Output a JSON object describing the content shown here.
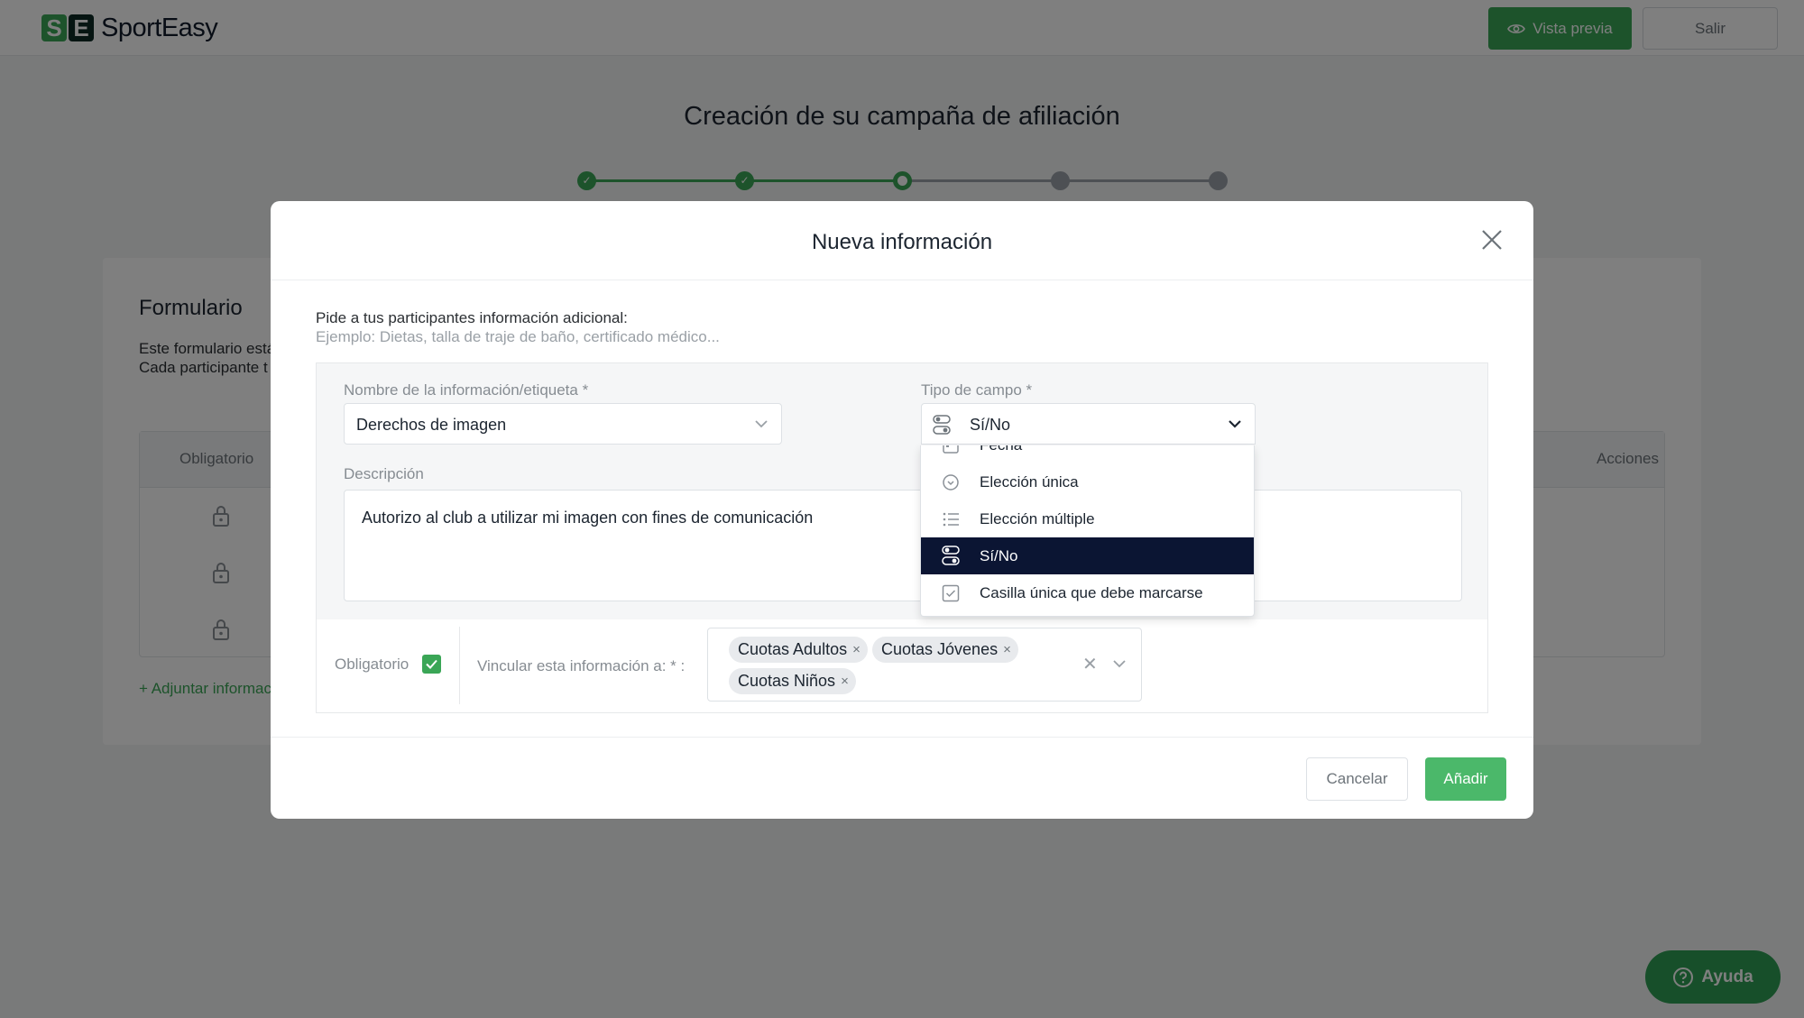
{
  "app": {
    "brand": "SportEasy",
    "logo_mark": [
      "S",
      "E"
    ]
  },
  "header": {
    "preview_label": "Vista previa",
    "exit_label": "Salir"
  },
  "page": {
    "title": "Creación de su campaña de afiliación"
  },
  "stepper": {
    "total_steps": 5,
    "completed_steps": 2,
    "current_step": 3,
    "check_glyph": "✓"
  },
  "form": {
    "title": "Formulario",
    "desc_line_1": "Este formulario está",
    "desc_line_2": "Cada participante t",
    "table_header_required": "Obligatorio",
    "table_header_actions": "Acciones",
    "attach_link": "+ Adjuntar informac"
  },
  "help": {
    "label": "Ayuda"
  },
  "modal": {
    "title": "Nueva información",
    "intro": "Pide a tus participantes información adicional:",
    "example": "Ejemplo: Dietas, talla de traje de baño, certificado médico...",
    "name_label": "Nombre de la información/etiqueta *",
    "name_value": "Derechos de imagen",
    "type_label": "Tipo de campo *",
    "type_value": "Sí/No",
    "description_label": "Descripción",
    "description_value": "Autorizo al club a utilizar mi imagen con fines de comunicación",
    "required_label": "Obligatorio",
    "required_checked": true,
    "link_label": "Vincular esta información a: * :",
    "linked_tags": [
      {
        "label": "Cuotas Adultos",
        "x": "×"
      },
      {
        "label": "Cuotas Jóvenes",
        "x": "×"
      },
      {
        "label": "Cuotas Niños",
        "x": "×"
      }
    ],
    "clear_glyph": "✕",
    "cancel_label": "Cancelar",
    "add_label": "Añadir"
  },
  "dropdown": {
    "options": [
      {
        "label": "Fecha",
        "icon": "calendar-icon"
      },
      {
        "label": "Elección única",
        "icon": "radio-icon"
      },
      {
        "label": "Elección múltiple",
        "icon": "list-icon"
      },
      {
        "label": "Sí/No",
        "icon": "toggle-icon",
        "selected": true
      },
      {
        "label": "Casilla única que debe marcarse",
        "icon": "checkbox-icon"
      }
    ]
  },
  "colors": {
    "brand_green": "#3aa656",
    "selected_option_bg": "#0b1533",
    "overlay": "rgba(0,0,0,0.5)"
  }
}
